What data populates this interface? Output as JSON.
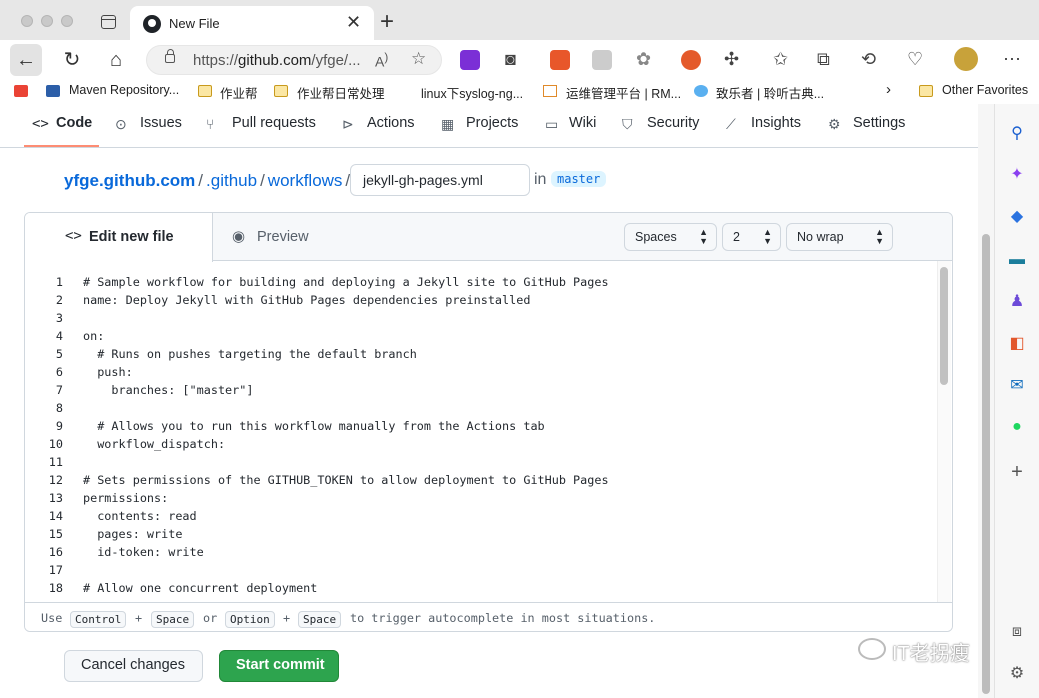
{
  "browser": {
    "tab_title": "New File",
    "url_prefix": "https://",
    "url_domain": "github.com",
    "url_path": "/yfge/...",
    "bookmarks": [
      "Maven Repository...",
      "作业帮",
      "作业帮日常处理",
      "linux下syslog-ng...",
      "运维管理平台 | RM...",
      "致乐者 | 聆听古典...",
      "Other Favorites"
    ]
  },
  "repo_nav": [
    {
      "label": "Code",
      "icon": "code-icon"
    },
    {
      "label": "Issues",
      "icon": "issue-icon"
    },
    {
      "label": "Pull requests",
      "icon": "pull-request-icon"
    },
    {
      "label": "Actions",
      "icon": "play-icon"
    },
    {
      "label": "Projects",
      "icon": "table-icon"
    },
    {
      "label": "Wiki",
      "icon": "book-icon"
    },
    {
      "label": "Security",
      "icon": "shield-icon"
    },
    {
      "label": "Insights",
      "icon": "graph-icon"
    },
    {
      "label": "Settings",
      "icon": "gear-icon"
    }
  ],
  "breadcrumb": {
    "repo": "yfge.github.com",
    "dir1": ".github",
    "dir2": "workflows",
    "sep": "/",
    "filename": "jekyll-gh-pages.yml",
    "in_text": "in",
    "branch": "master"
  },
  "editor": {
    "tab_edit": "Edit new file",
    "tab_preview": "Preview",
    "indent_mode": "Spaces",
    "indent_size": "2",
    "wrap_mode": "No wrap",
    "lines": [
      {
        "n": "1",
        "text": "# Sample workflow for building and deploying a Jekyll site to GitHub Pages"
      },
      {
        "n": "2",
        "text": "name: Deploy Jekyll with GitHub Pages dependencies preinstalled"
      },
      {
        "n": "3",
        "text": ""
      },
      {
        "n": "4",
        "text": "on:"
      },
      {
        "n": "5",
        "text": "  # Runs on pushes targeting the default branch"
      },
      {
        "n": "6",
        "text": "  push:"
      },
      {
        "n": "7",
        "text": "    branches: [\"master\"]"
      },
      {
        "n": "8",
        "text": ""
      },
      {
        "n": "9",
        "text": "  # Allows you to run this workflow manually from the Actions tab"
      },
      {
        "n": "10",
        "text": "  workflow_dispatch:"
      },
      {
        "n": "11",
        "text": ""
      },
      {
        "n": "12",
        "text": "# Sets permissions of the GITHUB_TOKEN to allow deployment to GitHub Pages"
      },
      {
        "n": "13",
        "text": "permissions:"
      },
      {
        "n": "14",
        "text": "  contents: read"
      },
      {
        "n": "15",
        "text": "  pages: write"
      },
      {
        "n": "16",
        "text": "  id-token: write"
      },
      {
        "n": "17",
        "text": ""
      },
      {
        "n": "18",
        "text": "# Allow one concurrent deployment"
      }
    ],
    "hint": {
      "use": "Use",
      "key1": "Control",
      "plus1": "+",
      "key2": "Space",
      "or": "or",
      "key3": "Option",
      "plus2": "+",
      "key4": "Space",
      "rest": "to trigger autocomplete in most situations."
    }
  },
  "actions": {
    "cancel": "Cancel changes",
    "commit": "Start commit"
  },
  "watermark": "IT老拐瘦",
  "colors": {
    "link": "#0969da",
    "commit_green": "#2da44e",
    "active_underline": "#fd8c73"
  }
}
